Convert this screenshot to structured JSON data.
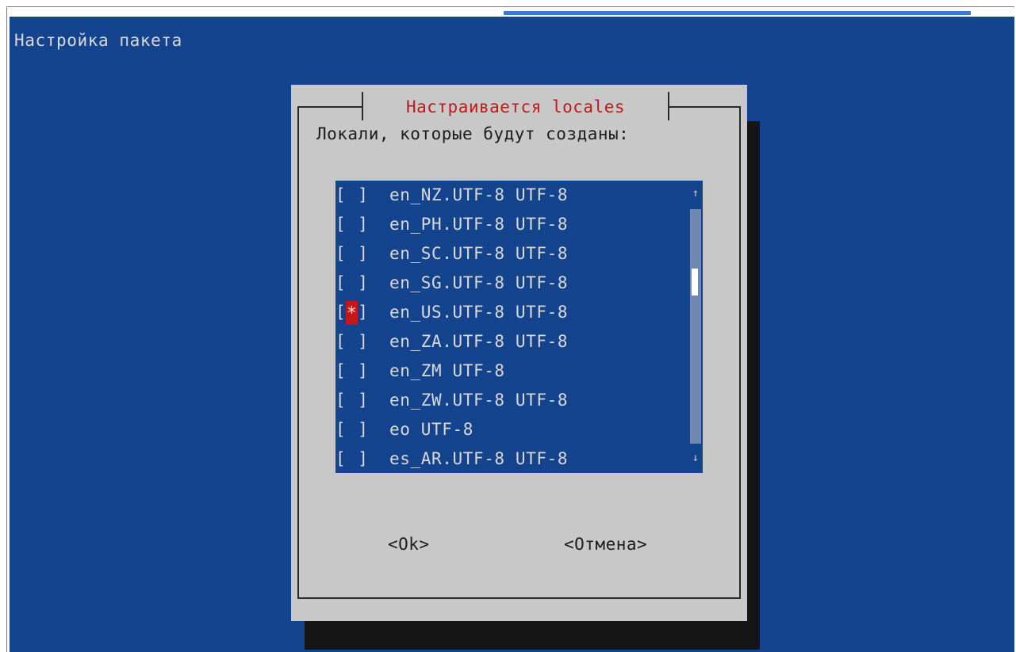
{
  "backtitle": "Настройка пакета",
  "dialog": {
    "title": "Настраивается locales",
    "prompt": "Локали, которые будут созданы:",
    "items": [
      {
        "mark": " ",
        "label": "en_NZ.UTF-8 UTF-8",
        "checked": false
      },
      {
        "mark": " ",
        "label": "en_PH.UTF-8 UTF-8",
        "checked": false
      },
      {
        "mark": " ",
        "label": "en_SC.UTF-8 UTF-8",
        "checked": false
      },
      {
        "mark": " ",
        "label": "en_SG.UTF-8 UTF-8",
        "checked": false
      },
      {
        "mark": "*",
        "label": "en_US.UTF-8 UTF-8",
        "checked": true
      },
      {
        "mark": " ",
        "label": "en_ZA.UTF-8 UTF-8",
        "checked": false
      },
      {
        "mark": " ",
        "label": "en_ZM UTF-8",
        "checked": false
      },
      {
        "mark": " ",
        "label": "en_ZW.UTF-8 UTF-8",
        "checked": false
      },
      {
        "mark": " ",
        "label": "eo UTF-8",
        "checked": false
      },
      {
        "mark": " ",
        "label": "es_AR.UTF-8 UTF-8",
        "checked": false
      }
    ],
    "scroll_up_glyph": "↑",
    "scroll_down_glyph": "↓",
    "ok_label": "<Ok>",
    "cancel_label": "<Отмена>"
  },
  "colors": {
    "background": "#14448e",
    "dialog": "#c8c8c8",
    "title_text": "#c41818",
    "checked_highlight": "#c41818"
  }
}
